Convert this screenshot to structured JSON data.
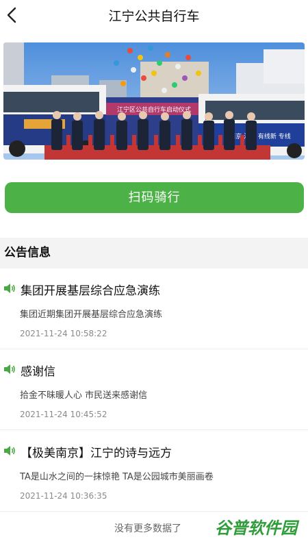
{
  "header": {
    "title": "江宁公共自行车",
    "back_icon": "chevron-left-icon"
  },
  "banner": {
    "sign_text": "江宁区公共自行车启动仪式",
    "bus_text_right": "南京·江宁 有线新 专线"
  },
  "scan_button": {
    "label": "扫码骑行"
  },
  "announcements": {
    "heading": "公告信息",
    "items": [
      {
        "title": "集团开展基层综合应急演练",
        "summary": "集团近期集团开展基层综合应急演练",
        "time": "2021-11-24 10:58:22"
      },
      {
        "title": "感谢信",
        "summary": "拾金不昧暖人心 市民送来感谢信",
        "time": "2021-11-24 10:45:52"
      },
      {
        "title": "【极美南京】江宁的诗与远方",
        "summary": "TA是山水之间的一抹惊艳 TA是公园城市美丽画卷",
        "time": "2021-11-24 10:36:35"
      }
    ]
  },
  "footer": {
    "no_more": "没有更多数据了"
  },
  "watermark": {
    "text": "谷普软件园"
  },
  "colors": {
    "accent": "#4cb247",
    "speaker": "#49a842",
    "section_bg": "#f3f3f3"
  }
}
